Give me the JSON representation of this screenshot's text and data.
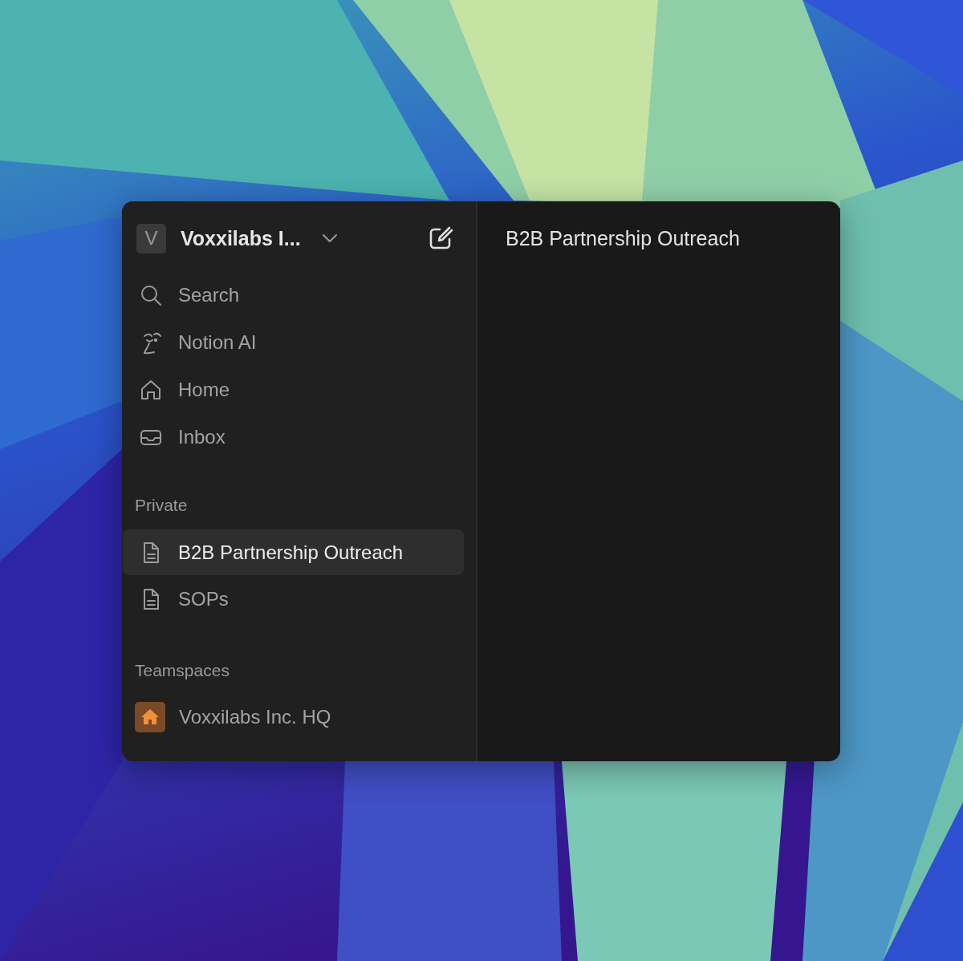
{
  "workspace": {
    "initial": "V",
    "name": "Voxxilabs I..."
  },
  "nav": [
    {
      "label": "Search",
      "kind": "search"
    },
    {
      "label": "Notion AI",
      "kind": "ai"
    },
    {
      "label": "Home",
      "kind": "home"
    },
    {
      "label": "Inbox",
      "kind": "inbox"
    }
  ],
  "sections": [
    {
      "title": "Private",
      "items": [
        {
          "label": "B2B Partnership Outreach",
          "kind": "page",
          "selected": true
        },
        {
          "label": "SOPs",
          "kind": "page",
          "selected": false
        }
      ]
    },
    {
      "title": "Teamspaces",
      "items": [
        {
          "label": "Voxxilabs Inc. HQ",
          "kind": "teamspace",
          "selected": false
        }
      ]
    }
  ],
  "page": {
    "title": "B2B Partnership Outreach"
  }
}
